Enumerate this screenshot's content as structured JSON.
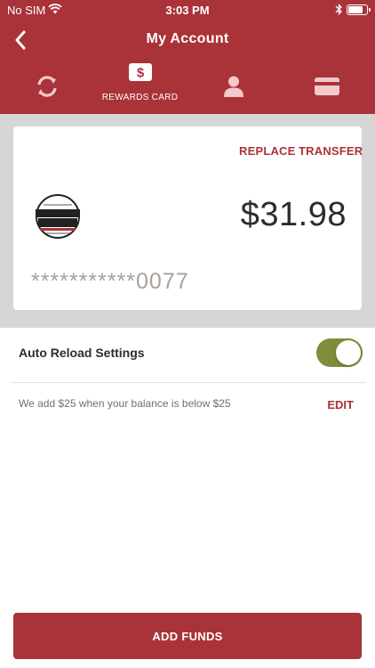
{
  "status_bar": {
    "carrier": "No SIM",
    "time": "3:03 PM"
  },
  "header": {
    "title": "My Account"
  },
  "tabs": [
    {
      "id": "refresh",
      "label": ""
    },
    {
      "id": "rewards-card",
      "label": "REWARDS CARD",
      "selected": true
    },
    {
      "id": "profile",
      "label": ""
    },
    {
      "id": "payment",
      "label": ""
    }
  ],
  "card": {
    "replace_label": "REPLACE",
    "transfer_label": "TRANSFER",
    "balance": "$31.98",
    "number_masked": "***********0077",
    "logo_text": "BRUEGGER'S BAGELS"
  },
  "auto_reload": {
    "title": "Auto Reload Settings",
    "enabled": true,
    "description": "We add $25 when your balance is below $25",
    "edit_label": "EDIT"
  },
  "footer": {
    "add_funds_label": "ADD FUNDS"
  },
  "colors": {
    "brand_red": "#a93339",
    "toggle_on": "#808c3a",
    "card_bg": "#d6d6d6"
  }
}
